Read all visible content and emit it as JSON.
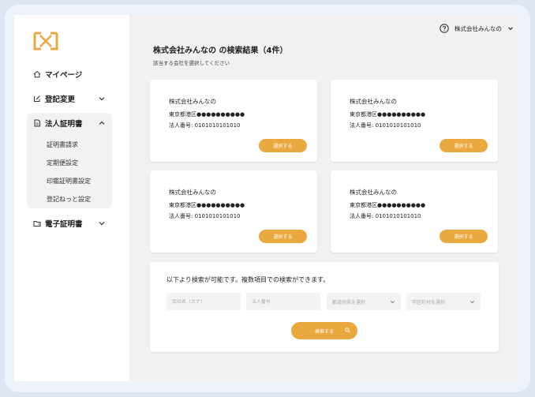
{
  "sidebar": {
    "items": [
      {
        "label": "マイページ",
        "icon": "home-icon"
      },
      {
        "label": "登記変更",
        "icon": "edit-icon"
      },
      {
        "label": "法人証明書",
        "icon": "document-icon"
      },
      {
        "label": "電子証明書",
        "icon": "folder-icon"
      }
    ],
    "sub_items": [
      "証明書請求",
      "定期便設定",
      "印鑑証明書設定",
      "登記ねっと設定"
    ]
  },
  "header": {
    "company_menu": "株式会社みんなの"
  },
  "main": {
    "title": "株式会社みんなの の検索結果（4件）",
    "subtitle": "該当する会社を選択してください",
    "cards": [
      {
        "name": "株式会社みんなの",
        "address": "東京都港区●●●●●●●●●●",
        "number": "法人番号: 0101010101010",
        "button": "選択する"
      },
      {
        "name": "株式会社みんなの",
        "address": "東京都港区●●●●●●●●●●",
        "number": "法人番号: 0101010101010",
        "button": "選択する"
      },
      {
        "name": "株式会社みんなの",
        "address": "東京都港区●●●●●●●●●●",
        "number": "法人番号: 0101010101010",
        "button": "選択する"
      },
      {
        "name": "株式会社みんなの",
        "address": "東京都港区●●●●●●●●●●",
        "number": "法人番号: 0101010101010",
        "button": "選択する"
      }
    ]
  },
  "search": {
    "title": "以下より検索が可能です。複数項目での検索ができます。",
    "fields": [
      {
        "placeholder": "会社名（カナ）"
      },
      {
        "placeholder": "法人番号"
      },
      {
        "placeholder": "都道府県を選択"
      },
      {
        "placeholder": "市区町村を選択"
      }
    ],
    "button": "検索する"
  },
  "colors": {
    "accent": "#eaa93e",
    "sidebar_bg": "#ffffff",
    "main_bg": "#f1f1f1"
  }
}
